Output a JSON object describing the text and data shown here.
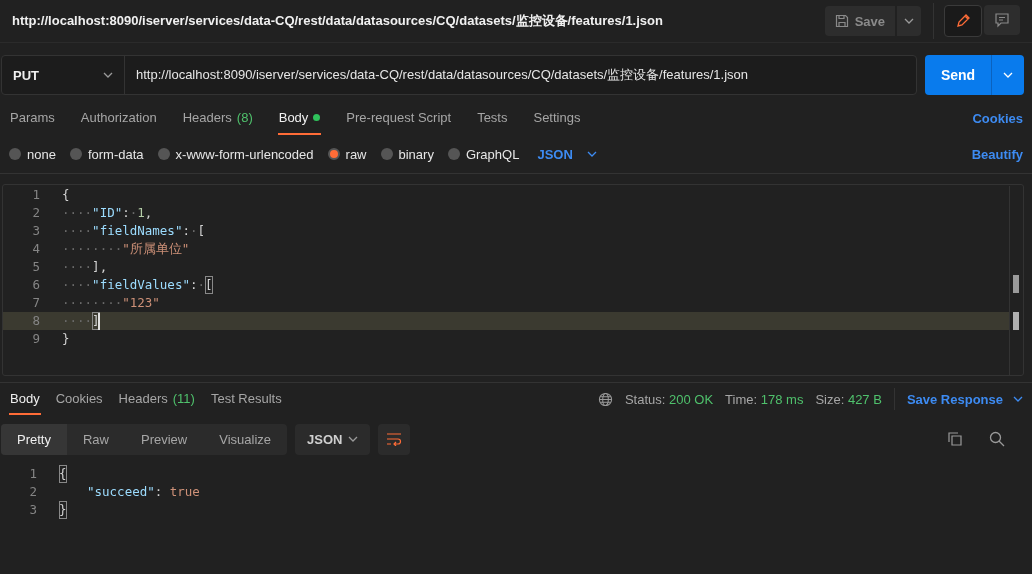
{
  "title_bar": {
    "url": "http://localhost:8090/iserver/services/data-CQ/rest/data/datasources/CQ/datasets/监控设备/features/1.json",
    "save": "Save",
    "view_modes": [
      {
        "kind": "edit",
        "selected": true
      },
      {
        "kind": "comment",
        "selected": false
      }
    ]
  },
  "request": {
    "method": "PUT",
    "url": "http://localhost:8090/iserver/services/data-CQ/rest/data/datasources/CQ/datasets/监控设备/features/1.json",
    "send": "Send"
  },
  "request_tabs": [
    {
      "label": "Params",
      "selected": false
    },
    {
      "label": "Authorization",
      "selected": false
    },
    {
      "label": "Headers",
      "count": "(8)",
      "selected": false
    },
    {
      "label": "Body",
      "dot": true,
      "selected": true
    },
    {
      "label": "Pre-request Script",
      "selected": false
    },
    {
      "label": "Tests",
      "selected": false
    },
    {
      "label": "Settings",
      "selected": false
    }
  ],
  "cookies": "Cookies",
  "body_types": [
    {
      "label": "none",
      "selected": false
    },
    {
      "label": "form-data",
      "selected": false
    },
    {
      "label": "x-www-form-urlencoded",
      "selected": false
    },
    {
      "label": "raw",
      "selected": true
    },
    {
      "label": "binary",
      "selected": false
    },
    {
      "label": "GraphQL",
      "selected": false
    }
  ],
  "body_format": "JSON",
  "beautify": "Beautify",
  "editor": {
    "lines": [
      {
        "number": "1",
        "current": false,
        "tokens": [
          {
            "kind": "punct",
            "text": "{"
          }
        ]
      },
      {
        "number": "2",
        "current": false,
        "tokens": [
          {
            "kind": "ws",
            "text": "····"
          },
          {
            "kind": "key",
            "text": "\"ID\""
          },
          {
            "kind": "punct",
            "text": ":"
          },
          {
            "kind": "ws",
            "text": "·"
          },
          {
            "kind": "number",
            "text": "1"
          },
          {
            "kind": "punct",
            "text": ","
          }
        ]
      },
      {
        "number": "3",
        "current": false,
        "tokens": [
          {
            "kind": "ws",
            "text": "····"
          },
          {
            "kind": "key",
            "text": "\"fieldNames\""
          },
          {
            "kind": "punct",
            "text": ":"
          },
          {
            "kind": "ws",
            "text": "·"
          },
          {
            "kind": "bracket",
            "text": "["
          }
        ]
      },
      {
        "number": "4",
        "current": false,
        "tokens": [
          {
            "kind": "ws",
            "text": "········"
          },
          {
            "kind": "string",
            "text": "\"所属单位\""
          }
        ]
      },
      {
        "number": "5",
        "current": false,
        "tokens": [
          {
            "kind": "ws",
            "text": "····"
          },
          {
            "kind": "bracket",
            "text": "]"
          },
          {
            "kind": "punct",
            "text": ","
          }
        ]
      },
      {
        "number": "6",
        "current": false,
        "tokens": [
          {
            "kind": "ws",
            "text": "····"
          },
          {
            "kind": "key",
            "text": "\"fieldValues\""
          },
          {
            "kind": "punct",
            "text": ":"
          },
          {
            "kind": "ws",
            "text": "·"
          },
          {
            "kind": "bracket",
            "text": "[",
            "matched": true
          }
        ]
      },
      {
        "number": "7",
        "current": false,
        "tokens": [
          {
            "kind": "ws",
            "text": "········"
          },
          {
            "kind": "string",
            "text": "\"123\""
          }
        ]
      },
      {
        "number": "8",
        "current": true,
        "tokens": [
          {
            "kind": "ws",
            "text": "····"
          },
          {
            "kind": "bracket",
            "text": "]",
            "matched": true
          }
        ]
      },
      {
        "number": "9",
        "current": false,
        "tokens": [
          {
            "kind": "punct",
            "text": "}"
          }
        ]
      }
    ]
  },
  "response_tabs": [
    {
      "label": "Body",
      "selected": true
    },
    {
      "label": "Cookies",
      "selected": false
    },
    {
      "label": "Headers",
      "count": "(11)",
      "selected": false
    },
    {
      "label": "Test Results",
      "selected": false
    }
  ],
  "status": [
    {
      "label": "Status:",
      "value": "200 OK"
    },
    {
      "label": "Time:",
      "value": "178 ms"
    },
    {
      "label": "Size:",
      "value": "427 B"
    }
  ],
  "save_response": "Save Response",
  "view_tabs": [
    {
      "label": "Pretty",
      "selected": true
    },
    {
      "label": "Raw",
      "selected": false
    },
    {
      "label": "Preview",
      "selected": false
    },
    {
      "label": "Visualize",
      "selected": false
    }
  ],
  "response_format": "JSON",
  "response": {
    "lines": [
      {
        "number": "1",
        "current": false,
        "tokens": [
          {
            "kind": "punct",
            "text": "{",
            "matched": true
          }
        ]
      },
      {
        "number": "2",
        "current": false,
        "indented": true,
        "tokens": [
          {
            "kind": "key",
            "text": "\"succeed\""
          },
          {
            "kind": "punct",
            "text": ": "
          },
          {
            "kind": "bool",
            "text": "true"
          }
        ]
      },
      {
        "number": "3",
        "current": false,
        "tokens": [
          {
            "kind": "punct",
            "text": "}",
            "matched": true
          }
        ]
      }
    ]
  }
}
